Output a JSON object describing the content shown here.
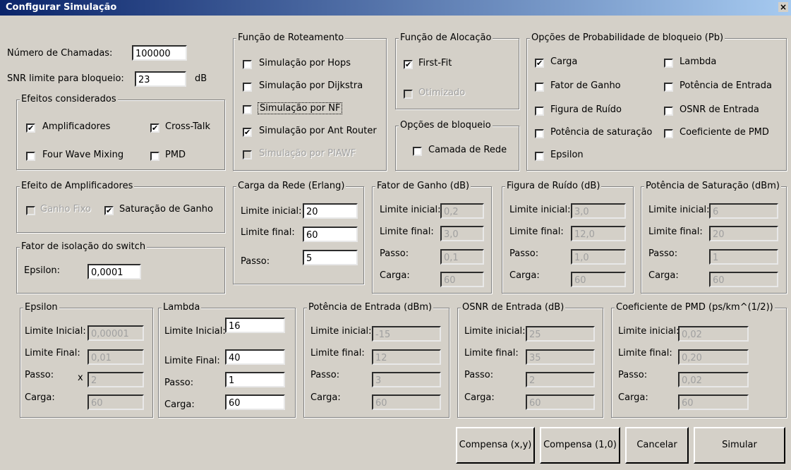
{
  "window": {
    "title": "Configurar Simulação",
    "close_glyph": "×"
  },
  "top": {
    "num_chamadas_label": "Número de Chamadas:",
    "num_chamadas_value": "100000",
    "snr_label": "SNR limite para bloqueio:",
    "snr_value": "23",
    "snr_unit": "dB"
  },
  "efeitos": {
    "title": "Efeitos considerados",
    "amplificadores": {
      "label": "Amplificadores",
      "checked": true
    },
    "cross_talk": {
      "label": "Cross-Talk",
      "checked": true
    },
    "four_wave": {
      "label": "Four Wave Mixing",
      "checked": false
    },
    "pmd": {
      "label": "PMD",
      "checked": false
    }
  },
  "roteamento": {
    "title": "Função de Roteamento",
    "items": [
      {
        "label": "Simulação por Hops",
        "checked": false,
        "enabled": true
      },
      {
        "label": "Simulação por Dijkstra",
        "checked": false,
        "enabled": true
      },
      {
        "label": "Simulação por NF",
        "checked": false,
        "enabled": true
      },
      {
        "label": "Simulação por Ant Router",
        "checked": true,
        "enabled": true
      },
      {
        "label": "Simulação por PIAWF",
        "checked": false,
        "enabled": false
      }
    ]
  },
  "alocacao": {
    "title": "Função de Alocação",
    "first_fit": {
      "label": "First-Fit",
      "checked": true
    },
    "otimizado": {
      "label": "Otimizado",
      "checked": false
    }
  },
  "bloqueio": {
    "title": "Opções de bloqueio",
    "camada": {
      "label": "Camada de Rede",
      "checked": false
    }
  },
  "prob": {
    "title": "Opções de Probabilidade de bloqueio (Pb)",
    "items": [
      {
        "label": "Carga",
        "checked": true
      },
      {
        "label": "Lambda",
        "checked": false
      },
      {
        "label": "Fator de Ganho",
        "checked": false
      },
      {
        "label": "Potência de Entrada",
        "checked": false
      },
      {
        "label": "Figura de Ruído",
        "checked": false
      },
      {
        "label": "OSNR de Entrada",
        "checked": false
      },
      {
        "label": "Potência de saturação",
        "checked": false
      },
      {
        "label": "Coeficiente de PMD",
        "checked": false
      },
      {
        "label": "Epsilon",
        "checked": false
      }
    ]
  },
  "amp": {
    "title": "Efeito de Amplificadores",
    "ganho_fixo": {
      "label": "Ganho Fixo",
      "checked": false
    },
    "saturacao": {
      "label": "Saturação de Ganho",
      "checked": true
    }
  },
  "isolacao": {
    "title": "Fator de isolação do switch",
    "label": "Epsilon:",
    "value": "0,0001"
  },
  "carga_rede": {
    "title": "Carga da Rede (Erlang)",
    "l1": "Limite inicial:",
    "v1": "20",
    "l2": "Limite final:",
    "v2": "60",
    "l3": "Passo:",
    "v3": "5"
  },
  "fator_ganho": {
    "title": "Fator de Ganho (dB)",
    "l1": "Limite inicial:",
    "v1": "0,2",
    "l2": "Limite final:",
    "v2": "3,0",
    "l3": "Passo:",
    "v3": "0,1",
    "l4": "Carga:",
    "v4": "60"
  },
  "figura_ruido": {
    "title": "Figura de Ruído (dB)",
    "l1": "Limite inicial:",
    "v1": "3,0",
    "l2": "Limite final:",
    "v2": "12,0",
    "l3": "Passo:",
    "v3": "1,0",
    "l4": "Carga:",
    "v4": "60"
  },
  "pot_sat": {
    "title": "Potência de Saturação (dBm)",
    "l1": "Limite inicial:",
    "v1": "6",
    "l2": "Limite final:",
    "v2": "20",
    "l3": "Passo:",
    "v3": "1",
    "l4": "Carga:",
    "v4": "60"
  },
  "epsilon": {
    "title": "Epsilon",
    "l1": "Limite Inicial:",
    "v1": "0,00001",
    "l2": "Limite Final:",
    "v2": "0,01",
    "l3": "Passo:",
    "x": "x",
    "v3": "2",
    "l4": "Carga:",
    "v4": "60"
  },
  "lambda": {
    "title": "Lambda",
    "l1": "Limite Inicial:",
    "v1": "16",
    "l2": "Limite Final:",
    "v2": "40",
    "l3": "Passo:",
    "v3": "1",
    "l4": "Carga:",
    "v4": "60"
  },
  "pot_entrada": {
    "title": "Potência de Entrada (dBm)",
    "l1": "Limite inicial:",
    "v1": "-15",
    "l2": "Limite final:",
    "v2": "12",
    "l3": "Passo:",
    "v3": "3",
    "l4": "Carga:",
    "v4": "60"
  },
  "osnr": {
    "title": "OSNR de Entrada (dB)",
    "l1": "Limite inicial:",
    "v1": "25",
    "l2": "Limite final:",
    "v2": "35",
    "l3": "Passo:",
    "v3": "2",
    "l4": "Carga:",
    "v4": "60"
  },
  "pmd_coef": {
    "title": "Coeficiente de PMD (ps/km^(1/2))",
    "l1": "Limite inicial:",
    "v1": "0,02",
    "l2": "Limite final:",
    "v2": "0,20",
    "l3": "Passo:",
    "v3": "0,02",
    "l4": "Carga:",
    "v4": "60"
  },
  "buttons": {
    "compensa_xy": "Compensa (x,y)",
    "compensa_10": "Compensa (1,0)",
    "cancelar": "Cancelar",
    "simular": "Simular"
  },
  "glyphs": {
    "check": "✔"
  }
}
